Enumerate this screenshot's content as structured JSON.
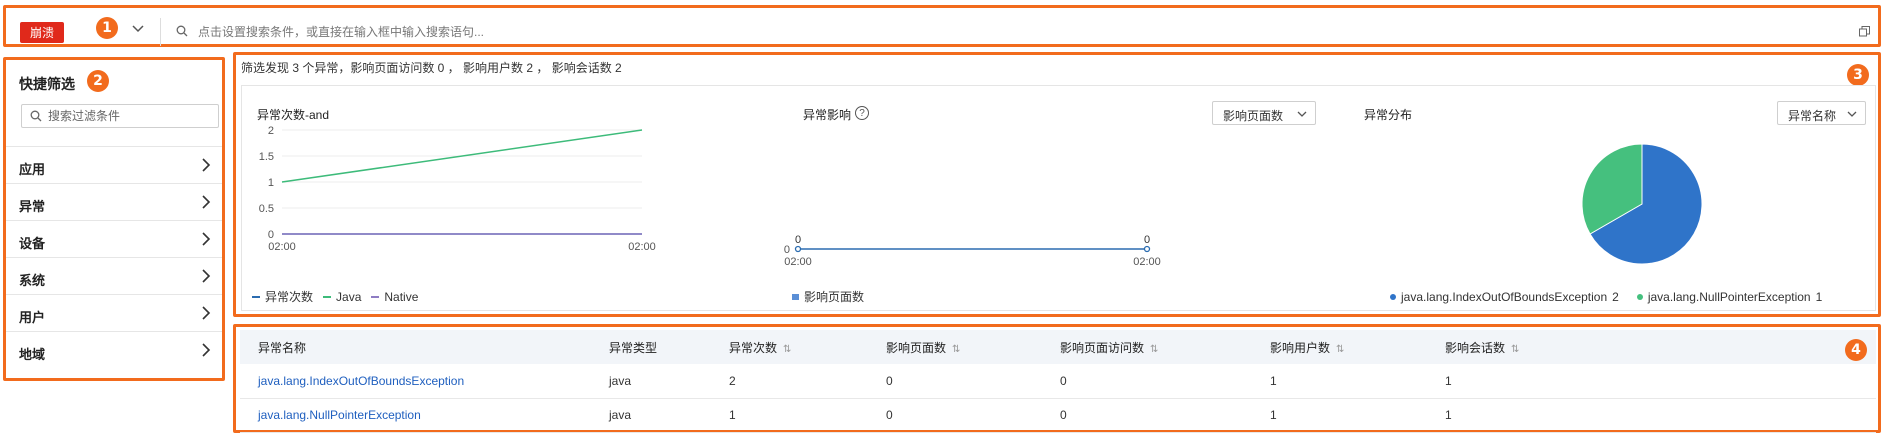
{
  "top_bar": {
    "crash_tag": "崩溃",
    "badge": "1",
    "search_placeholder": "点击设置搜索条件，或直接在输入框中输入搜索语句..."
  },
  "sidebar": {
    "badge": "2",
    "title": "快捷筛选",
    "search_placeholder": "搜索过滤条件",
    "items": [
      {
        "label": "应用"
      },
      {
        "label": "异常"
      },
      {
        "label": "设备"
      },
      {
        "label": "系统"
      },
      {
        "label": "用户"
      },
      {
        "label": "地域"
      }
    ]
  },
  "charts_panel": {
    "badge": "3",
    "summary": "筛选发现 3 个异常，影响页面访问数 0 ， 影响用户数 2 ， 影响会话数 2",
    "chart1": {
      "title": "异常次数-and",
      "legend": [
        {
          "name": "异常次数",
          "color": "#2b6cb0"
        },
        {
          "name": "Java",
          "color": "#3dbb7a"
        },
        {
          "name": "Native",
          "color": "#8e7cc3"
        }
      ]
    },
    "chart2": {
      "title": "异常影响",
      "select_value": "影响页面数",
      "legend": [
        {
          "name": "影响页面数",
          "color": "#5b8fd6"
        }
      ]
    },
    "chart3": {
      "title": "异常分布",
      "select_value": "异常名称",
      "legend": [
        {
          "name": "java.lang.IndexOutOfBoundsException",
          "value": "2",
          "color": "#2f74c9"
        },
        {
          "name": "java.lang.NullPointerException",
          "value": "1",
          "color": "#45c07e"
        }
      ]
    }
  },
  "chart_data": [
    {
      "type": "line",
      "title": "异常次数-and",
      "x": [
        "02:00",
        "02:00"
      ],
      "ylim": [
        0,
        2
      ],
      "yticks": [
        "0",
        "0.5",
        "1",
        "1.5",
        "2"
      ],
      "series": [
        {
          "name": "异常次数",
          "values": [
            0,
            0
          ],
          "color": "#2b6cb0"
        },
        {
          "name": "Java",
          "values": [
            1,
            2
          ],
          "color": "#3dbb7a"
        },
        {
          "name": "Native",
          "values": [
            0,
            0
          ],
          "color": "#8e7cc3"
        }
      ]
    },
    {
      "type": "line",
      "title": "异常影响",
      "x": [
        "02:00",
        "02:00"
      ],
      "yticks": [
        "0"
      ],
      "series": [
        {
          "name": "影响页面数",
          "values": [
            0,
            0
          ],
          "color": "#2b6cb0"
        }
      ]
    },
    {
      "type": "pie",
      "title": "异常分布",
      "slices": [
        {
          "name": "java.lang.IndexOutOfBoundsException",
          "value": 2,
          "color": "#2f74c9"
        },
        {
          "name": "java.lang.NullPointerException",
          "value": 1,
          "color": "#45c07e"
        }
      ]
    }
  ],
  "table": {
    "badge": "4",
    "columns": [
      "异常名称",
      "异常类型",
      "异常次数",
      "影响页面数",
      "影响页面访问数",
      "影响用户数",
      "影响会话数"
    ],
    "rows": [
      [
        "java.lang.IndexOutOfBoundsException",
        "java",
        "2",
        "0",
        "0",
        "1",
        "1"
      ],
      [
        "java.lang.NullPointerException",
        "java",
        "1",
        "0",
        "0",
        "1",
        "1"
      ]
    ]
  }
}
